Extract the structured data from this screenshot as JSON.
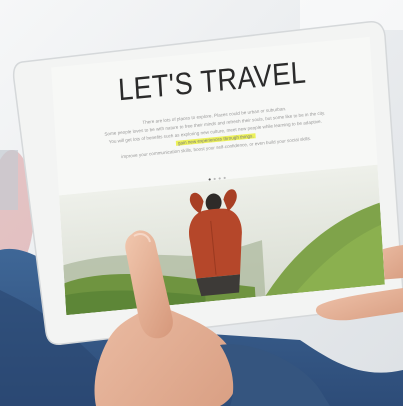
{
  "screen": {
    "headline": "LET'S TRAVEL",
    "paragraph_lines": [
      "There are lots of places to explore. Places could be urban or suburban.",
      "Some people loves to be with nature to free their minds and refresh their souls, but some like to be in the city.",
      "You will get lots of benefits such as exploring new culture, meet new people while learning to be adaptive."
    ],
    "highlight": "gain new experiences through things.",
    "paragraph_tail": "improve your communication skills, boost your self-confidence, or even build your social skills.",
    "carousel": {
      "dots": 4,
      "active": 0
    }
  },
  "colors": {
    "highlight": "#ecf15a",
    "jacket": "#b5472a",
    "hills": "#7fa34a",
    "sleeve": "#3c5f8f"
  }
}
